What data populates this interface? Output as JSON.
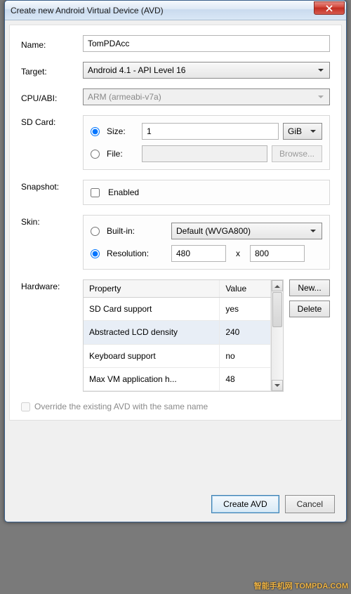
{
  "window": {
    "title": "Create new Android Virtual Device (AVD)"
  },
  "labels": {
    "name": "Name:",
    "target": "Target:",
    "cpuabi": "CPU/ABI:",
    "sdcard": "SD Card:",
    "snapshot": "Snapshot:",
    "skin": "Skin:",
    "hardware": "Hardware:"
  },
  "name": {
    "value": "TomPDAcc"
  },
  "target": {
    "value": "Android 4.1 - API Level 16"
  },
  "cpuabi": {
    "value": "ARM (armeabi-v7a)",
    "disabled": true
  },
  "sdcard": {
    "size_label": "Size:",
    "size_value": "1",
    "unit": "GiB",
    "file_label": "File:",
    "file_value": "",
    "browse": "Browse..."
  },
  "snapshot": {
    "enabled_label": "Enabled",
    "checked": false
  },
  "skin": {
    "builtin_label": "Built-in:",
    "builtin_value": "Default (WVGA800)",
    "resolution_label": "Resolution:",
    "res_w": "480",
    "res_x": "x",
    "res_h": "800"
  },
  "hardware": {
    "columns": {
      "prop": "Property",
      "val": "Value"
    },
    "rows": [
      {
        "prop": "SD Card support",
        "val": "yes"
      },
      {
        "prop": "Abstracted LCD density",
        "val": "240",
        "sel": true
      },
      {
        "prop": "Keyboard support",
        "val": "no"
      },
      {
        "prop": "Max VM application h...",
        "val": "48"
      }
    ],
    "new": "New...",
    "delete": "Delete"
  },
  "override": {
    "label": "Override the existing AVD with the same name"
  },
  "footer": {
    "create": "Create AVD",
    "cancel": "Cancel"
  },
  "watermark": "智能手机网\nTOMPDA.COM"
}
